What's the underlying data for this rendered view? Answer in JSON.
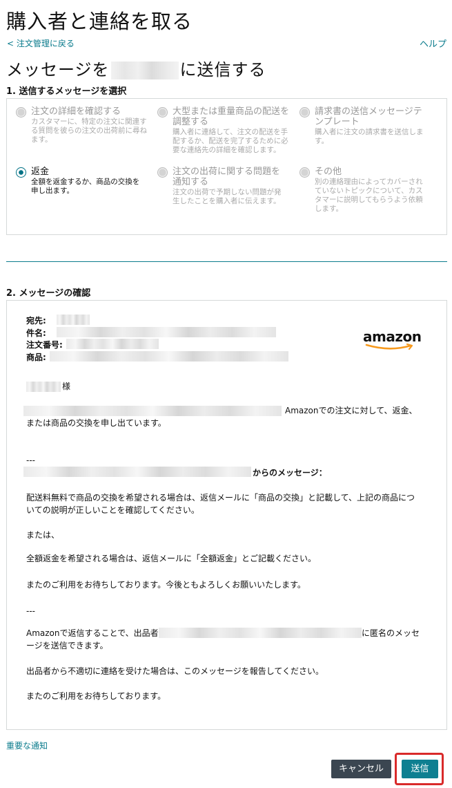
{
  "header": {
    "title": "購入者と連絡を取る",
    "back_link": "< 注文管理に戻る",
    "help_link": "ヘルプ",
    "send_heading_prefix": "メッセージを",
    "send_heading_suffix": "に送信する"
  },
  "section1": {
    "title": "1. 送信するメッセージを選択",
    "options": [
      {
        "title": "注文の詳細を確認する",
        "desc": "カスタマーに、特定の注文に関連する質問を彼らの注文の出荷前に尋ねます。",
        "selected": false
      },
      {
        "title": "大型または重量商品の配送を調整する",
        "desc": "購入者に連絡して、注文の配送を手配するか、配送を完了するために必要な連絡先の詳細を確認します。",
        "selected": false
      },
      {
        "title": "請求書の送信メッセージテンプレート",
        "desc": "購入者に注文の請求書を送信します。",
        "selected": false
      },
      {
        "title": "返金",
        "desc": "全額を返金するか、商品の交換を申し出ます。",
        "selected": true
      },
      {
        "title": "注文の出荷に関する問題を通知する",
        "desc": "注文の出荷で予期しない問題が発生したことを購入者に伝えます。",
        "selected": false
      },
      {
        "title": "その他",
        "desc": "別の連絡理由によってカバーされていないトピックについて、カスタマーに説明してもらうよう依頼します。",
        "selected": false
      }
    ]
  },
  "section2": {
    "title": "2. メッセージの確認",
    "to_label": "宛先:",
    "subject_label": "件名:",
    "order_label": "注文番号:",
    "product_label": "商品:",
    "logo_text": "amazon",
    "salutation_suffix": "様",
    "intro": "Amazonでの注文に対して、返金、または商品の交換を申し出ています。",
    "sep1": "---",
    "from_suffix": "からのメッセージ：",
    "para1": "配送料無料で商品の交換を希望される場合は、返信メールに「商品の交換」と記載して、上記の商品についての説明が正しいことを確認してください。",
    "para2": "または、",
    "para3": "全額返金を希望される場合は、返信メールに「全額返金」とご記載ください。",
    "para4": "またのご利用をお待ちしております。今後ともよろしくお願いいたします。",
    "sep2": "---",
    "anon_prefix": "Amazonで返信することで、出品者",
    "anon_suffix": "に匿名のメッセージを送信できます。",
    "report": "出品者から不適切に連絡を受けた場合は、このメッセージを報告してください。",
    "closing": "またのご利用をお待ちしております。"
  },
  "footer": {
    "notice_link": "重要な通知",
    "cancel_label": "キャンセル",
    "send_label": "送信"
  },
  "colors": {
    "accent": "#0a7b8c",
    "cancel_bg": "#3b4651",
    "send_bg": "#0e7f91",
    "highlight": "#d92a2a"
  }
}
